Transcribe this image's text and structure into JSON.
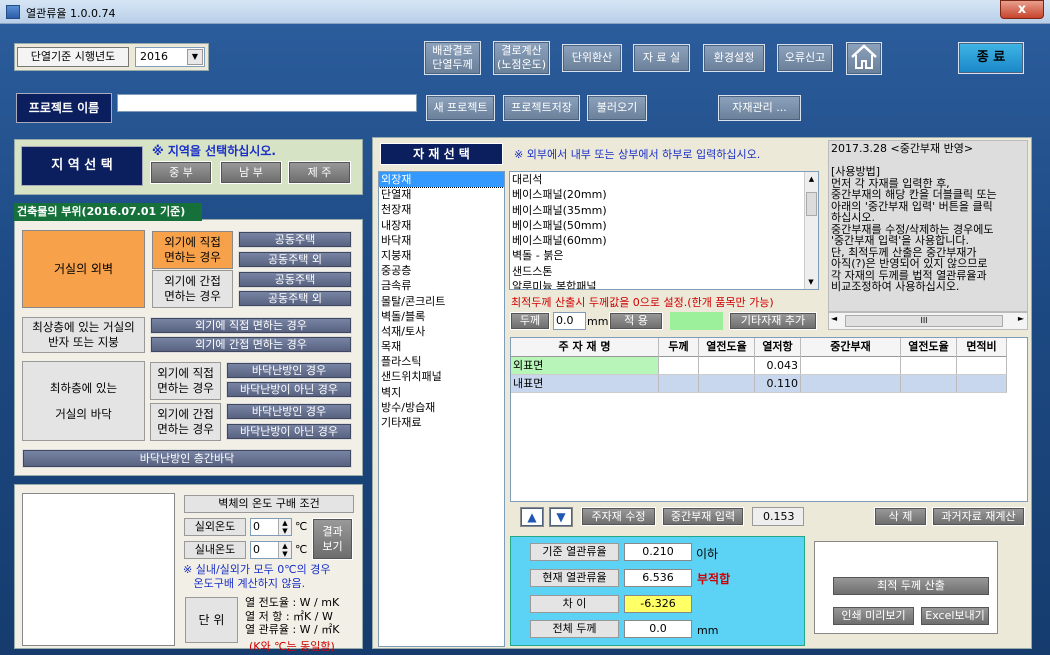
{
  "window": {
    "title": "열관류율 1.0.0.74",
    "close": "x"
  },
  "header": {
    "year_label": "단열기준 시행년도",
    "year_value": "2016",
    "toolbar": [
      "배관결로\n단열두께",
      "결로계산\n(노점온도)",
      "단위환산",
      "자 료 실",
      "환경설정",
      "오류신고"
    ],
    "exit": "종 료"
  },
  "project": {
    "label": "프로젝트 이름",
    "name": "",
    "new": "새 프로젝트",
    "save": "프로젝트저장",
    "load": "불러오기",
    "material_mgmt": "자재관리 ..."
  },
  "region": {
    "title": "지 역 선 택",
    "notice": "※ 지역을 선택하십시오.",
    "options": [
      "중 부",
      "남 부",
      "제 주"
    ]
  },
  "building": {
    "title": "건축물의 부위(2016.07.01 기준)",
    "wall": "거실의 외벽",
    "wall_direct": "외기에 직접\n면하는 경우",
    "wall_indirect": "외기에 간접\n면하는 경우",
    "apt": "공동주택",
    "apt_ext": "공동주택 외",
    "roof": "최상층에 있는 거실의\n반자 또는 지붕",
    "roof_direct": "외기에 직접 면하는 경우",
    "roof_indirect": "외기에 간접 면하는 경우",
    "floor": "최하층에 있는\n\n거실의 바닥",
    "floor_direct": "외기에 직접\n면하는 경우",
    "floor_indirect": "외기에 간접\n면하는 경우",
    "heated": "바닥난방인 경우",
    "not_heated": "바닥난방이 아닌 경우",
    "intermediate": "바닥난방인 층간바닥"
  },
  "temp": {
    "title": "벽체의 온도 구배 조건",
    "outdoor": "실외온도",
    "indoor": "실내온도",
    "outdoor_val": "0",
    "indoor_val": "0",
    "unit": "℃",
    "show": "결과\n보기",
    "note": "※ 실내/실외가 모두 0℃의 경우\n   온도구배 계산하지 않음.",
    "unit_btn": "단 위",
    "units": [
      "열 전도율 : W / mK",
      "열  저  항 : ㎡K / W",
      "열 관류율 : W / ㎡K"
    ],
    "units_note": "(K와 ℃는 동일함)"
  },
  "material": {
    "title": "자 재 선 택",
    "categories": [
      "외장재",
      "단열재",
      "천장재",
      "내장재",
      "바닥재",
      "지붕재",
      "중공층",
      "금속류",
      "몰탈/콘크리트",
      "벽돌/블록",
      "석재/토사",
      "목재",
      "플라스틱",
      "샌드위치패널",
      "벽지",
      "방수/방습재",
      "기타재료"
    ],
    "instruction": "※ 외부에서 내부 또는 상부에서 하부로 입력하십시오.",
    "items": [
      "대리석",
      "베이스패널(20mm)",
      "베이스패널(35mm)",
      "베이스패널(50mm)",
      "베이스패널(60mm)",
      "벽돌 - 붉은",
      "샌드스톤",
      "알루미늄 복합패널"
    ],
    "zero_note": "최적두께 산출시 두께값을 0으로 설정.(한개 품목만 가능)",
    "thickness_label": "두께",
    "thickness_val": "0.0",
    "mm": "mm",
    "apply": "적 용",
    "other": "기타자재 추가"
  },
  "notes": {
    "text": "2017.3.28 <중간부재 반영>\n\n[사용방법]\n먼저 각 자재를 입력한 후,\n중간부재의 해당 칸을 더블클릭 또는\n아래의 '중간부재 입력' 버튼을 클릭\n하십시오.\n중간부재를 수정/삭제하는 경우에도\n'중간부재 입력'을 사용합니다.\n단, 최적두께 산출은 중간부재가\n아직(?)은 반영되어 있지 않으므로\n각 자재의 두께를 법적 열관류율과\n비교조정하여 사용하십시오.",
    "scroll": "III"
  },
  "table": {
    "headers": [
      "주 자 재 명",
      "두께",
      "열전도율",
      "열저항",
      "중간부재",
      "열전도율",
      "면적비"
    ],
    "rows": [
      [
        "외표면",
        "",
        "",
        "0.043",
        "",
        "",
        ""
      ],
      [
        "내표면",
        "",
        "",
        "0.110",
        "",
        "",
        ""
      ]
    ]
  },
  "actions": {
    "up": "▲",
    "down": "▼",
    "edit": "주자재 수정",
    "mid": "중간부재 입력",
    "total": "0.153",
    "delete": "삭 제",
    "recalc": "과거자료 재계산"
  },
  "result": {
    "std_label": "기준 열관류율",
    "std_val": "0.210",
    "std_suffix": "이하",
    "cur_label": "현재 열관류율",
    "cur_val": "6.536",
    "cur_suffix": "부적합",
    "diff_label": "차    이",
    "diff_val": "-6.326",
    "thick_label": "전체 두께",
    "thick_val": "0.0",
    "thick_unit": "mm",
    "optimal": "최적 두께 산출",
    "print": "인쇄 미리보기",
    "excel": "Excel보내기"
  }
}
